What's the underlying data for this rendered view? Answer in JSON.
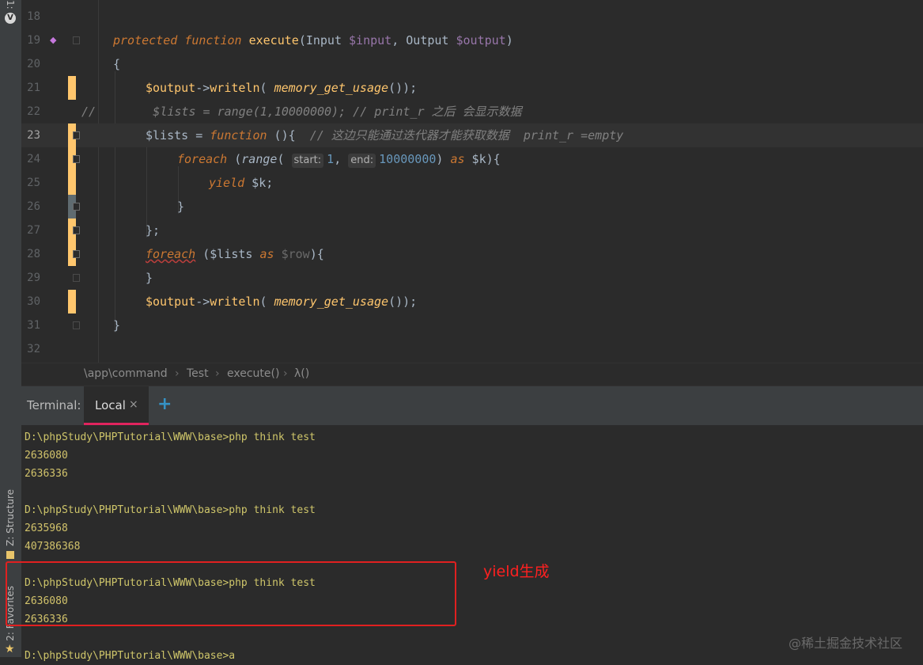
{
  "tool_strip": {
    "project_tab": "1:",
    "structure_tab": "Z: Structure",
    "favorites_tab": "2: Favorites"
  },
  "editor": {
    "lines": [
      {
        "num": "18"
      },
      {
        "num": "19"
      },
      {
        "num": "20"
      },
      {
        "num": "21"
      },
      {
        "num": "22"
      },
      {
        "num": "23"
      },
      {
        "num": "24"
      },
      {
        "num": "25"
      },
      {
        "num": "26"
      },
      {
        "num": "27"
      },
      {
        "num": "28"
      },
      {
        "num": "29"
      },
      {
        "num": "30"
      },
      {
        "num": "31"
      },
      {
        "num": "32"
      }
    ],
    "code": {
      "l19": {
        "kw1": "protected",
        "kw2": "function",
        "fname": "execute",
        "open": "(",
        "type1": "Input ",
        "param1": "$input",
        "sep": ", ",
        "type2": "Output ",
        "param2": "$output",
        "close": ")"
      },
      "l20": {
        "text": "{"
      },
      "l21": {
        "var": "$output",
        "arrow": "->",
        "method": "writeln",
        "open": "( ",
        "call": "memory_get_usage",
        "close": "());"
      },
      "l22": {
        "text": "//        $lists = range(1,10000000); // print_r 之后 会显示数据"
      },
      "l23": {
        "var": "$lists",
        "eq": " = ",
        "kw": "function",
        "rest": " (){  ",
        "comment": "// 这边只能通过迭代器才能获取数据  print_r =empty"
      },
      "l24": {
        "kw": "foreach",
        "open": " (",
        "call": "range",
        "paren": "( ",
        "hint1": "start:",
        "n1": "1",
        "comma": ", ",
        "hint2": "end:",
        "n2": "10000000",
        "close": ") ",
        "as": "as",
        "var": " $k",
        "end": "){"
      },
      "l25": {
        "kw": "yield",
        "var": " $k",
        "end": ";"
      },
      "l26": {
        "text": "}"
      },
      "l27": {
        "text": "};"
      },
      "l28": {
        "kw": "foreach",
        "open": " (",
        "var": "$lists ",
        "as": "as",
        "row": " $row",
        "end": "){"
      },
      "l29": {
        "text": "}"
      },
      "l30": {
        "var": "$output",
        "arrow": "->",
        "method": "writeln",
        "open": "( ",
        "call": "memory_get_usage",
        "close": "());"
      },
      "l31": {
        "text": "}"
      }
    }
  },
  "breadcrumb": {
    "items": [
      "\\app\\command",
      "Test",
      "execute()",
      "λ()"
    ],
    "separator": "›"
  },
  "terminal": {
    "title": "Terminal:",
    "tab_label": "Local",
    "close_glyph": "×",
    "add_glyph": "+",
    "lines": [
      "D:\\phpStudy\\PHPTutorial\\WWW\\base>php think test",
      "2636080",
      "2636336",
      "",
      "D:\\phpStudy\\PHPTutorial\\WWW\\base>php think test",
      "2635968",
      "407386368",
      "",
      "D:\\phpStudy\\PHPTutorial\\WWW\\base>php think test",
      "2636080",
      "2636336",
      "",
      "D:\\phpStudy\\PHPTutorial\\WWW\\base>a"
    ],
    "annotation": "yield生成",
    "watermark": "@稀土掘金技术社区"
  },
  "colors": {
    "background": "#2b2b2b",
    "keyword": "#cc7832",
    "function_name": "#ffc66d",
    "variable": "#9876aa",
    "number": "#6897bb",
    "comment": "#808080",
    "terminal_text": "#cfc66a",
    "accent_tab": "#e0245e",
    "annotation_red": "#ff2020"
  },
  "icons": {
    "project": "vue-logo-icon",
    "bookmark": "bookmark-icon",
    "close": "close-icon",
    "add": "plus-icon"
  }
}
